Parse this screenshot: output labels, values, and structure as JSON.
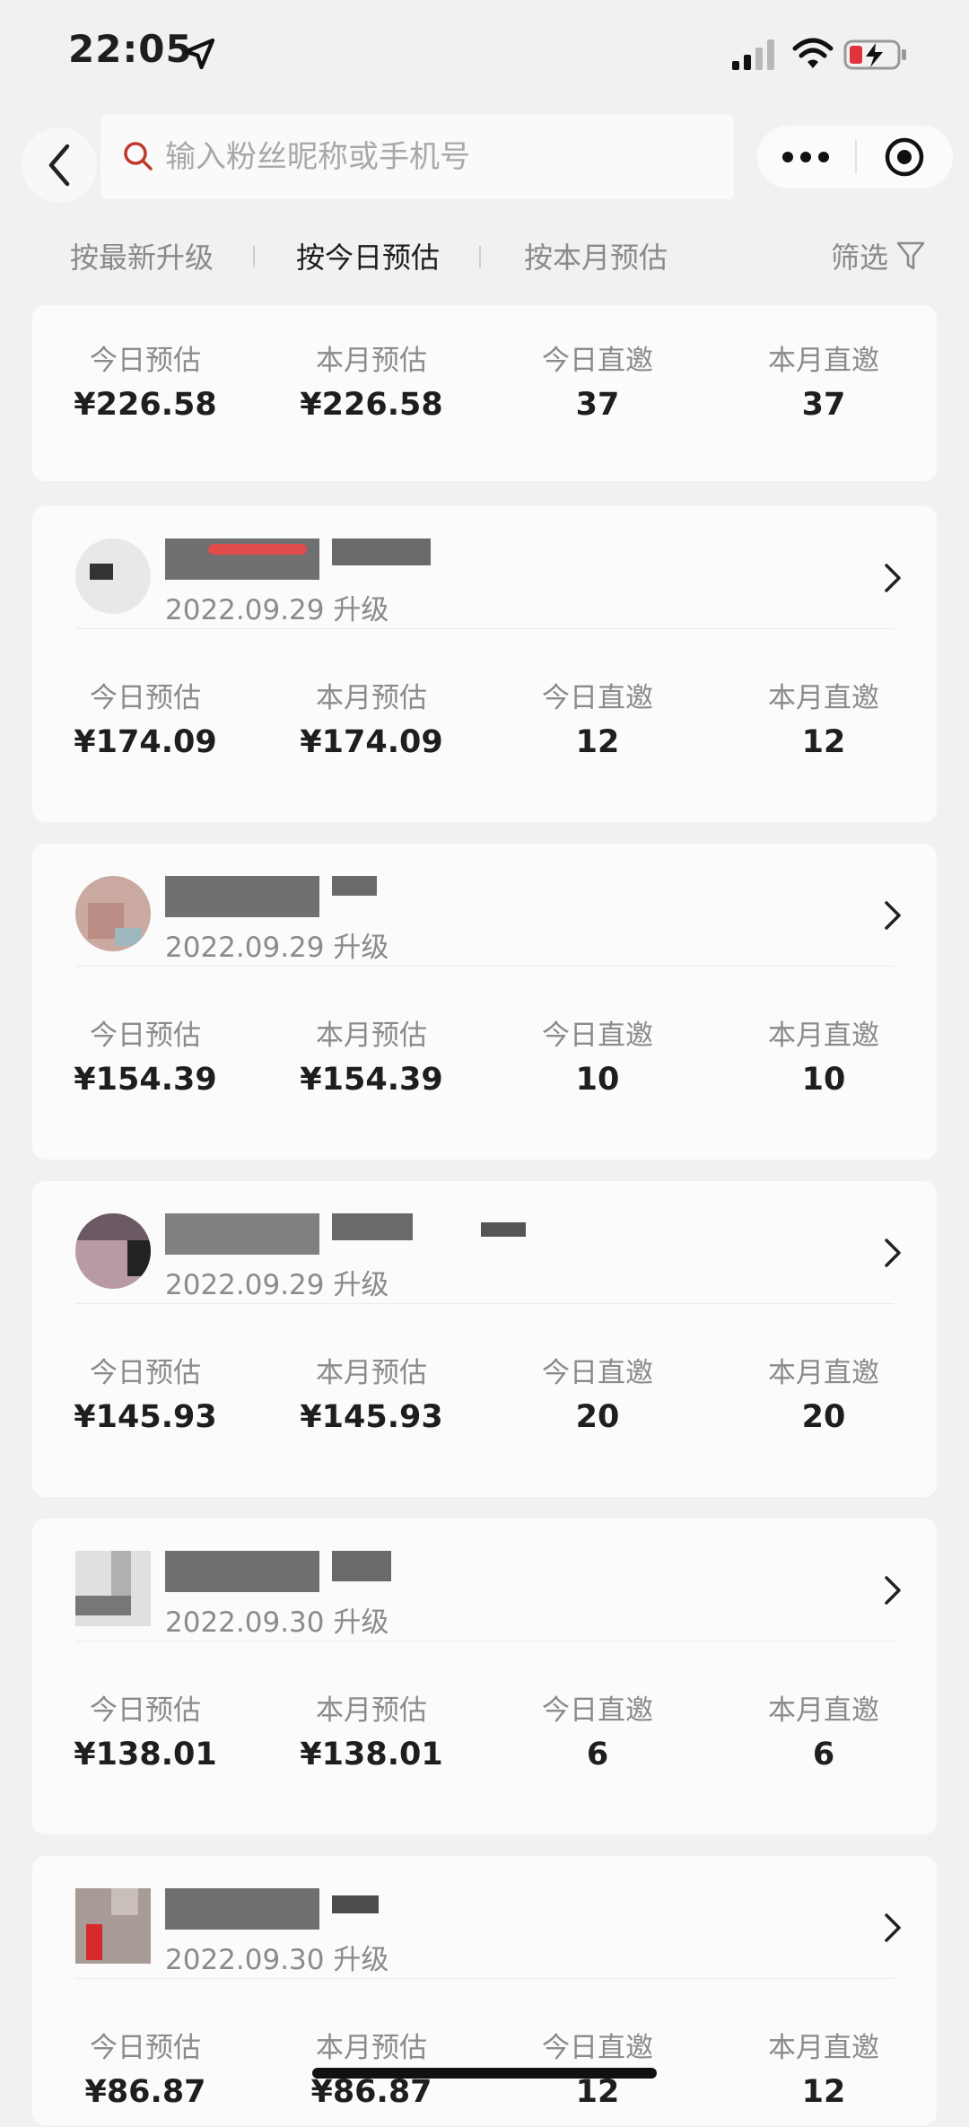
{
  "status_bar": {
    "time": "22:05"
  },
  "search": {
    "placeholder": "输入粉丝昵称或手机号"
  },
  "sort_tabs": [
    "按最新升级",
    "按今日预估",
    "按本月预估"
  ],
  "filter_label": "筛选",
  "stat_labels": [
    "今日预估",
    "本月预估",
    "今日直邀",
    "本月直邀"
  ],
  "summary": {
    "values": [
      "¥226.58",
      "¥226.58",
      "37",
      "37"
    ]
  },
  "members": [
    {
      "date": "2022.09.29 升级",
      "values": [
        "¥174.09",
        "¥174.09",
        "12",
        "12"
      ]
    },
    {
      "date": "2022.09.29 升级",
      "values": [
        "¥154.39",
        "¥154.39",
        "10",
        "10"
      ]
    },
    {
      "date": "2022.09.29 升级",
      "values": [
        "¥145.93",
        "¥145.93",
        "20",
        "20"
      ]
    },
    {
      "date": "2022.09.30 升级",
      "values": [
        "¥138.01",
        "¥138.01",
        "6",
        "6"
      ]
    },
    {
      "date": "2022.09.30 升级",
      "values": [
        "¥86.87",
        "¥86.87",
        "12",
        "12"
      ]
    }
  ],
  "colors": {
    "background": "#f1f1f1",
    "card": "#fbfbfb",
    "muted_text": "#8b8b8b",
    "primary_text": "#1e1e1e"
  }
}
